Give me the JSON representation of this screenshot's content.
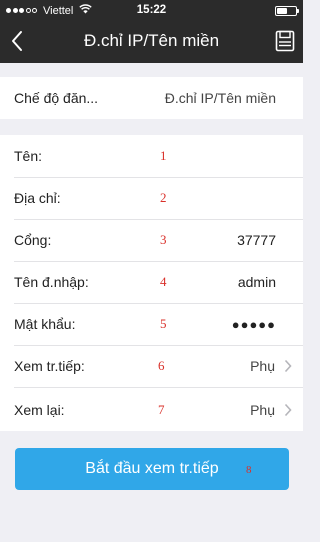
{
  "status_bar": {
    "carrier": "Viettel",
    "time": "15:22"
  },
  "navbar": {
    "title": "Đ.chỉ IP/Tên miền"
  },
  "mode_row": {
    "label": "Chế độ đăn...",
    "value": "Đ.chỉ IP/Tên miền"
  },
  "fields": [
    {
      "label": "Tên:",
      "value": "",
      "marker": "1"
    },
    {
      "label": "Địa chỉ:",
      "value": "",
      "marker": "2"
    },
    {
      "label": "Cổng:",
      "value": "37777",
      "marker": "3"
    },
    {
      "label": "Tên đ.nhập:",
      "value": "admin",
      "marker": "4"
    },
    {
      "label": "Mật khẩu:",
      "value": "●●●●●",
      "marker": "5"
    },
    {
      "label": "Xem tr.tiếp:",
      "value": "Phụ",
      "marker": "6"
    },
    {
      "label": "Xem lại:",
      "value": "Phụ",
      "marker": "7"
    }
  ],
  "start_button": {
    "label": "Bắt đầu xem tr.tiếp",
    "marker": "8"
  },
  "colors": {
    "header_bg": "#2b2b2b",
    "button_bg": "#30a7e8",
    "annotation_red": "#d9302a",
    "page_bg": "#efeff4"
  }
}
